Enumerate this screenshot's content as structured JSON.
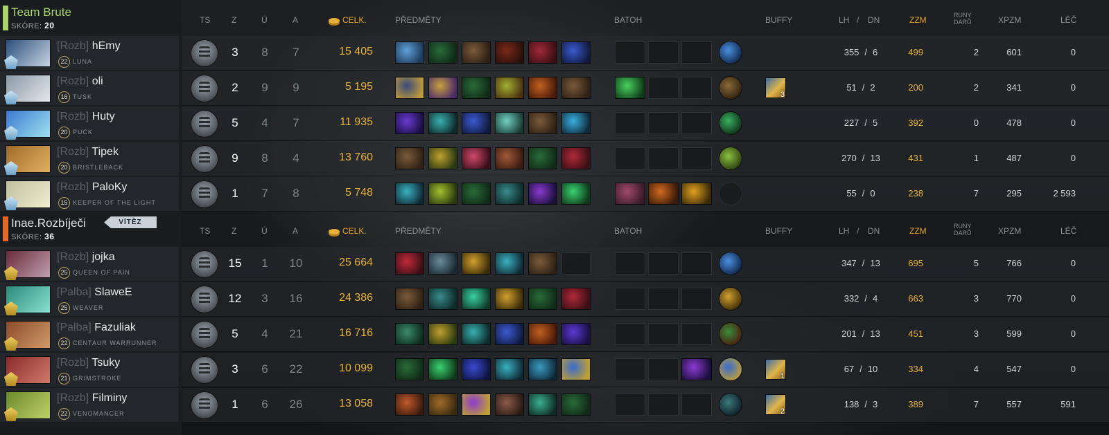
{
  "columns": {
    "ts": "TS",
    "kills": "Z",
    "deaths": "Ú",
    "assists": "A",
    "networth": "CELK.",
    "items": "PŘEDMĚTY",
    "backpack": "BATOH",
    "buffs": "BUFFY",
    "lh": "LH",
    "sep": "/",
    "dn": "DN",
    "gpm": "ZZM",
    "runes_1": "RUNY",
    "runes_2": "DARŮ",
    "xpm": "XPZM",
    "heal": "LÉČ"
  },
  "teams": [
    {
      "name": "Team Brute",
      "score_label": "SKÓRE:",
      "score": "20",
      "color": "#a9d36b",
      "players": [
        {
          "role": "[Rozb]",
          "name": "hEmy",
          "level": "22",
          "hero": "LUNA",
          "k": "3",
          "d": "8",
          "a": "7",
          "nw": "15 405",
          "lh": "355",
          "dn": "6",
          "gpm": "499",
          "runes": "2",
          "xpm": "601",
          "heal": "0",
          "portrait": [
            "#2b4f7a",
            "#c7d4e4"
          ],
          "rank_icon": "crown-icon",
          "items": [
            [
              "#5fa0d8",
              "#1c3a5a"
            ],
            [
              "#2a6b3a",
              "#0f2a16"
            ],
            [
              "#7a5a3a",
              "#2e2014"
            ],
            [
              "#7a2a1a",
              "#2a0f0a"
            ],
            [
              "#a02a3a",
              "#3a0f14"
            ],
            [
              "#3a5ad0",
              "#101a40"
            ]
          ],
          "backpack": [
            null,
            null,
            null
          ],
          "neutral": [
            "#4a90e0",
            "#0e2244"
          ],
          "buff": null
        },
        {
          "role": "[Rozb]",
          "name": "oli",
          "level": "16",
          "hero": "TUSK",
          "k": "2",
          "d": "9",
          "a": "9",
          "nw": "5 195",
          "lh": "51",
          "dn": "2",
          "gpm": "200",
          "runes": "2",
          "xpm": "341",
          "heal": "0",
          "portrait": [
            "#8a98a6",
            "#e4e8ec"
          ],
          "rank_icon": "crown-icon",
          "items": [
            [
              "#3a4a7a",
              "#c09a3a"
            ],
            [
              "#c7a040",
              "#4a2a6a"
            ],
            [
              "#2a6b3a",
              "#0f2a16"
            ],
            [
              "#a0b030",
              "#4a3010"
            ],
            [
              "#c06020",
              "#4a1a08"
            ],
            [
              "#7a5a3a",
              "#2e2014"
            ]
          ],
          "backpack": [
            [
              "#4ad060",
              "#0e3a18"
            ],
            null,
            null
          ],
          "neutral": [
            "#8a6a3a",
            "#2a1e0e"
          ],
          "buff": {
            "count": "3"
          }
        },
        {
          "role": "[Rozb]",
          "name": "Huty",
          "level": "20",
          "hero": "PUCK",
          "k": "5",
          "d": "4",
          "a": "7",
          "nw": "11 935",
          "lh": "227",
          "dn": "5",
          "gpm": "392",
          "runes": "0",
          "xpm": "478",
          "heal": "0",
          "portrait": [
            "#3a7ad0",
            "#a0e0f0"
          ],
          "rank_icon": "crown-icon",
          "items": [
            [
              "#6a3ad0",
              "#1a0e44"
            ],
            [
              "#3ab0b0",
              "#0e2a2a"
            ],
            [
              "#3a5ad0",
              "#101a40"
            ],
            [
              "#70d0c0",
              "#1a3a34"
            ],
            [
              "#7a5a3a",
              "#2e2014"
            ],
            [
              "#3ab0e0",
              "#0e2a3a"
            ]
          ],
          "backpack": [
            null,
            null,
            null
          ],
          "neutral": [
            "#3ab060",
            "#0e2a18"
          ],
          "buff": null
        },
        {
          "role": "[Rozb]",
          "name": "Tipek",
          "level": "20",
          "hero": "BRISTLEBACK",
          "k": "9",
          "d": "8",
          "a": "4",
          "nw": "13 760",
          "lh": "270",
          "dn": "13",
          "gpm": "431",
          "runes": "1",
          "xpm": "487",
          "heal": "0",
          "portrait": [
            "#a06a2a",
            "#e0b060"
          ],
          "rank_icon": "crown-icon",
          "items": [
            [
              "#7a5a3a",
              "#2e2014"
            ],
            [
              "#c0a030",
              "#2a3a10"
            ],
            [
              "#d04a6a",
              "#3a0e1a"
            ],
            [
              "#a05a3a",
              "#3a1a0e"
            ],
            [
              "#2a6b3a",
              "#0f2a16"
            ],
            [
              "#b02a3a",
              "#3a0e14"
            ]
          ],
          "backpack": [
            null,
            null,
            null
          ],
          "neutral": [
            "#8ac040",
            "#2a3a0e"
          ],
          "buff": null
        },
        {
          "role": "[Rozb]",
          "name": "PaloKy",
          "level": "15",
          "hero": "KEEPER OF THE LIGHT",
          "k": "1",
          "d": "7",
          "a": "8",
          "nw": "5 748",
          "lh": "55",
          "dn": "0",
          "gpm": "238",
          "runes": "7",
          "xpm": "295",
          "heal": "2 593",
          "portrait": [
            "#c0c0a0",
            "#f0ecd0"
          ],
          "rank_icon": "crown-icon",
          "items": [
            [
              "#3ab0c0",
              "#0e2a34"
            ],
            [
              "#a0c030",
              "#2a3a0e"
            ],
            [
              "#2a6b3a",
              "#0f2a16"
            ],
            [
              "#3a8a8a",
              "#0e2a2a"
            ],
            [
              "#8a3ad0",
              "#1a0e3a"
            ],
            [
              "#3ad070",
              "#0e3a1a"
            ]
          ],
          "backpack": [
            [
              "#a04a6a",
              "#3a1a2a"
            ],
            [
              "#d06a20",
              "#3a1a08"
            ],
            [
              "#e0a020",
              "#3a2a08"
            ]
          ],
          "neutral": null,
          "buff": null
        }
      ]
    },
    {
      "name": "Inae.Rozbíječi",
      "score_label": "SKÓRE:",
      "score": "36",
      "winner_label": "VÍTĚZ",
      "color": "#e06a2a",
      "players": [
        {
          "role": "[Rozb]",
          "name": "jojka",
          "level": "25",
          "hero": "QUEEN OF PAIN",
          "k": "15",
          "d": "1",
          "a": "10",
          "nw": "25 664",
          "lh": "347",
          "dn": "13",
          "gpm": "695",
          "runes": "5",
          "xpm": "766",
          "heal": "0",
          "portrait": [
            "#6a2a3a",
            "#c0a0b0"
          ],
          "rank_icon": "crown-icon",
          "items": [
            [
              "#c02a3a",
              "#3a0e14"
            ],
            [
              "#6a8a9a",
              "#1a2a34"
            ],
            [
              "#d0a030",
              "#3a2a08"
            ],
            [
              "#3ab0c0",
              "#0e2a34"
            ],
            [
              "#7a5a3a",
              "#2e2014"
            ],
            null
          ],
          "backpack": [
            null,
            null,
            null
          ],
          "neutral": [
            "#4a90e0",
            "#0e2244"
          ],
          "buff": null
        },
        {
          "role": "[Palba]",
          "name": "SlaweE",
          "level": "25",
          "hero": "WEAVER",
          "k": "12",
          "d": "3",
          "a": "16",
          "nw": "24 386",
          "lh": "332",
          "dn": "4",
          "gpm": "663",
          "runes": "3",
          "xpm": "770",
          "heal": "0",
          "portrait": [
            "#2a8a7a",
            "#8ae0d0"
          ],
          "rank_icon": "crown-icon",
          "items": [
            [
              "#7a5a3a",
              "#2e2014"
            ],
            [
              "#3a8a8a",
              "#0e2a2a"
            ],
            [
              "#3ad0a0",
              "#0e3a2a"
            ],
            [
              "#d0a030",
              "#3a2a08"
            ],
            [
              "#2a6b3a",
              "#0f2a16"
            ],
            [
              "#b02a3a",
              "#3a0e14"
            ]
          ],
          "backpack": [
            null,
            null,
            null
          ],
          "neutral": [
            "#d0a030",
            "#3a2a08"
          ],
          "buff": null
        },
        {
          "role": "[Palba]",
          "name": "Fazuliak",
          "level": "22",
          "hero": "CENTAUR WARRUNNER",
          "k": "5",
          "d": "4",
          "a": "21",
          "nw": "16 716",
          "lh": "201",
          "dn": "13",
          "gpm": "451",
          "runes": "3",
          "xpm": "599",
          "heal": "0",
          "portrait": [
            "#8a4a2a",
            "#d09a6a"
          ],
          "rank_icon": "crown-icon",
          "items": [
            [
              "#3a8a6a",
              "#0e2a20"
            ],
            [
              "#c0a030",
              "#2a3a10"
            ],
            [
              "#3ab0b0",
              "#0e2a2a"
            ],
            [
              "#3a5ad0",
              "#101a40"
            ],
            [
              "#c06020",
              "#4a1a08"
            ],
            [
              "#5a3ad0",
              "#1a0e44"
            ]
          ],
          "backpack": [
            null,
            null,
            null
          ],
          "neutral": [
            "#3a8a3a",
            "#4a1a0e"
          ],
          "buff": null
        },
        {
          "role": "[Rozb]",
          "name": "Tsuky",
          "level": "21",
          "hero": "GRIMSTROKE",
          "k": "3",
          "d": "6",
          "a": "22",
          "nw": "10 099",
          "lh": "67",
          "dn": "10",
          "gpm": "334",
          "runes": "4",
          "xpm": "547",
          "heal": "0",
          "portrait": [
            "#8a2a2a",
            "#d07a6a"
          ],
          "rank_icon": "crown-icon",
          "items": [
            [
              "#2a6b3a",
              "#0f2a16"
            ],
            [
              "#3ad070",
              "#0e3a1a"
            ],
            [
              "#3a4ad0",
              "#0e1440"
            ],
            [
              "#3ab0c0",
              "#0e2a34"
            ],
            [
              "#3a9ac0",
              "#0e2a3a"
            ],
            [
              "#3a6ad0",
              "#c0a030"
            ]
          ],
          "backpack": [
            null,
            null,
            [
              "#8a3ad0",
              "#1a0e3a"
            ]
          ],
          "neutral": [
            "#3a6ad0",
            "#c0a030"
          ],
          "buff": {
            "count": "1"
          }
        },
        {
          "role": "[Rozb]",
          "name": "Filminy",
          "level": "22",
          "hero": "VENOMANCER",
          "k": "1",
          "d": "6",
          "a": "26",
          "nw": "13 058",
          "lh": "138",
          "dn": "3",
          "gpm": "389",
          "runes": "7",
          "xpm": "557",
          "heal": "591",
          "portrait": [
            "#6a8a2a",
            "#c0d06a"
          ],
          "rank_icon": "crown-icon",
          "items": [
            [
              "#c05a2a",
              "#3a1a0e"
            ],
            [
              "#a06a2a",
              "#3a2a0e"
            ],
            [
              "#8a3ad0",
              "#c0a030"
            ],
            [
              "#8a5a4a",
              "#2a1a14"
            ],
            [
              "#3ab090",
              "#0e2a24"
            ],
            [
              "#2a6b3a",
              "#0f2a16"
            ]
          ],
          "backpack": [
            null,
            null,
            null
          ],
          "neutral": [
            "#3a7a7a",
            "#0e1a24"
          ],
          "buff": {
            "count": "2"
          }
        }
      ]
    }
  ]
}
